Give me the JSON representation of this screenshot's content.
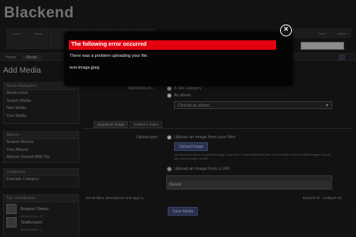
{
  "app": {
    "brand": "Blackend"
  },
  "topnav": {
    "tabs": [
      "Home",
      "Home",
      "",
      "",
      "",
      "",
      ""
    ],
    "right_tabs": [
      "",
      "Other",
      "Admin"
    ]
  },
  "breadcrumb": {
    "first": "Home",
    "second": "Media"
  },
  "page": {
    "title": "Add Media"
  },
  "sidebar": {
    "media_nav": {
      "heading": "Media Navigation",
      "items": [
        "Media Index",
        "Search Media",
        "New Media",
        "Your Media"
      ]
    },
    "albums": {
      "heading": "Albums",
      "items": [
        "Browse Albums",
        "Your Albums",
        "Albums Shared With You"
      ]
    },
    "categories": {
      "heading": "Categories",
      "items": [
        "Example Category"
      ]
    },
    "contributors": {
      "heading": "Top Contributors",
      "users": [
        {
          "name": "Brandon Sheley",
          "detail": "Media Items: 13"
        },
        {
          "name": "TestAccount",
          "detail": "Media Items: 1"
        }
      ]
    }
  },
  "form": {
    "add_media_to_label": "Add Media to...",
    "option_site_category": "A Site Category",
    "option_album": "An album",
    "album_select_placeholder": "Choose an album...",
    "tabs": [
      "Upload an Image",
      "Embed a Video"
    ],
    "upload_type_label": "Upload type:",
    "upload_from_files": "Upload an image from your files",
    "upload_button": "Upload Image",
    "help_text": "Use the button above to upload an image. If you have a Flash-enabled browser, you'll be able to select multiple images. You can also upload images via URL.",
    "upload_from_url": "Upload an Image from a URL",
    "details_label": "Details",
    "set_all_label": "Set all titles, descriptions and tags to...",
    "expand_all": "Expand All",
    "collapse_all": "Collapse All",
    "save_button": "Save Media"
  },
  "modal": {
    "title": "The following error occurred",
    "message": "There was a problem uploading your file.",
    "filename": "test-image.jpeg",
    "close_icon": "close-icon",
    "accent_color": "#e3000f"
  }
}
